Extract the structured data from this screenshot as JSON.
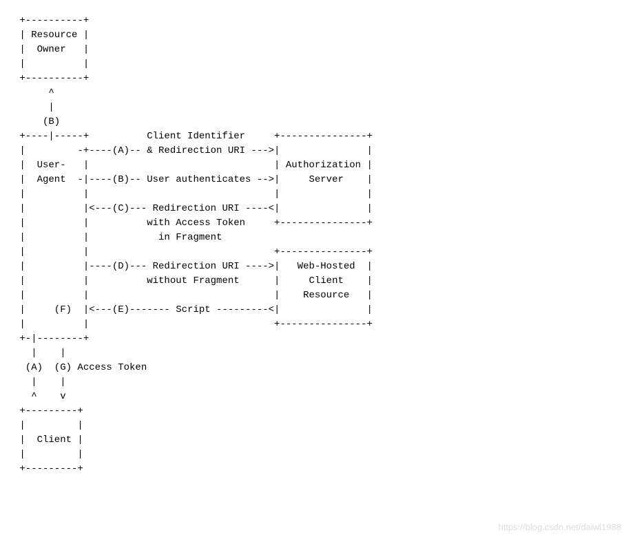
{
  "diagram": {
    "lines": [
      " +----------+",
      " | Resource |",
      " |  Owner   |",
      " |          |",
      " +----------+",
      "      ^",
      "      |",
      "     (B)",
      " +----|-----+          Client Identifier     +---------------+",
      " |         -+----(A)-- & Redirection URI --->|               |",
      " |  User-   |                                | Authorization |",
      " |  Agent  -|----(B)-- User authenticates -->|     Server    |",
      " |          |                                |               |",
      " |          |<---(C)--- Redirection URI ----<|               |",
      " |          |          with Access Token     +---------------+",
      " |          |            in Fragment",
      " |          |                                +---------------+",
      " |          |----(D)--- Redirection URI ---->|   Web-Hosted  |",
      " |          |          without Fragment      |     Client    |",
      " |          |                                |    Resource   |",
      " |     (F)  |<---(E)------- Script ---------<|               |",
      " |          |                                +---------------+",
      " +-|--------+",
      "   |    |",
      "  (A)  (G) Access Token",
      "   |    |",
      "   ^    v",
      " +---------+",
      " |         |",
      " |  Client |",
      " |         |",
      " +---------+"
    ]
  },
  "watermark": "https://blog.csdn.net/daiwl1988"
}
